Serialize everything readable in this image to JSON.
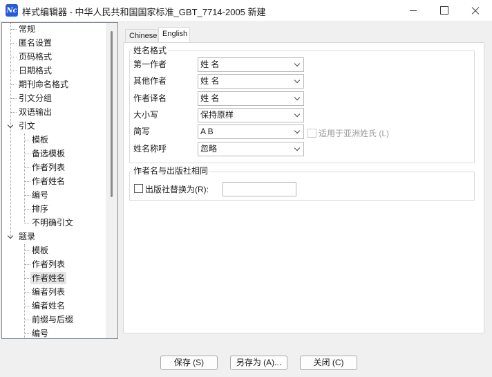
{
  "window": {
    "title": "样式编辑器 - 中华人民共和国国家标准_GBT_7714-2005 新建"
  },
  "tree": {
    "items": [
      {
        "label": "常规"
      },
      {
        "label": "匿名设置"
      },
      {
        "label": "页码格式"
      },
      {
        "label": "日期格式"
      },
      {
        "label": "期刊命名格式"
      },
      {
        "label": "引文分组"
      },
      {
        "label": "双语输出"
      },
      {
        "label": "引文"
      },
      {
        "label": "模板"
      },
      {
        "label": "备选模板"
      },
      {
        "label": "作者列表"
      },
      {
        "label": "作者姓名"
      },
      {
        "label": "编号"
      },
      {
        "label": "排序"
      },
      {
        "label": "不明确引文"
      },
      {
        "label": "题录"
      },
      {
        "label": "模板"
      },
      {
        "label": "作者列表"
      },
      {
        "label": "作者姓名"
      },
      {
        "label": "编者列表"
      },
      {
        "label": "编者姓名"
      },
      {
        "label": "前缀与后缀"
      },
      {
        "label": "编号"
      }
    ]
  },
  "tabs": [
    {
      "label": "Chinese"
    },
    {
      "label": "English"
    }
  ],
  "name_format": {
    "group_title": "姓名格式",
    "fields": [
      {
        "label": "第一作者",
        "value": "姓 名"
      },
      {
        "label": "其他作者",
        "value": "姓 名"
      },
      {
        "label": "作者译名",
        "value": "姓 名"
      },
      {
        "label": "大小写",
        "value": "保持原样"
      },
      {
        "label": "简写",
        "value": "A B"
      },
      {
        "label": "姓名称呼",
        "value": "忽略"
      }
    ],
    "asian_checkbox_label": "适用于亚洲姓氏 (L)"
  },
  "same_as_publisher": {
    "group_title": "作者名与出版社相同",
    "checkbox_label": "出版社替换为(R):",
    "input_value": ""
  },
  "buttons": {
    "save": "保存 (S)",
    "save_as": "另存为 (A)...",
    "close": "关闭 (C)"
  }
}
